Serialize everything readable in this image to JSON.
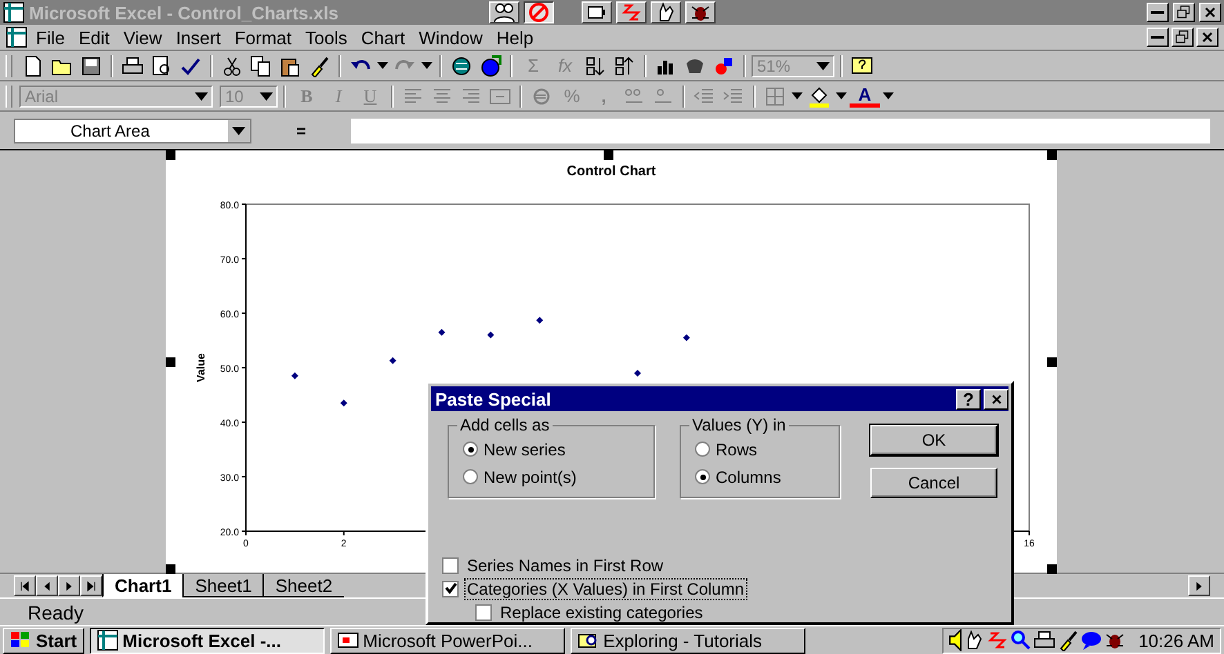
{
  "window": {
    "title": "Microsoft Excel - Control_Charts.xls"
  },
  "menu": [
    "File",
    "Edit",
    "View",
    "Insert",
    "Format",
    "Tools",
    "Chart",
    "Window",
    "Help"
  ],
  "standard_toolbar": {
    "sum": "Σ",
    "function": "fx",
    "zoom": "51%"
  },
  "formatting_toolbar": {
    "font": "Arial",
    "size": "10",
    "bold": "B",
    "italic": "I",
    "underline": "U",
    "percent": "%",
    "comma": ",",
    "font_color": "A",
    "disabled": true
  },
  "formula_bar": {
    "name_box": "Chart Area",
    "equals": "="
  },
  "chart": {
    "chart_data": {
      "type": "scatter",
      "title": "Control Chart",
      "ylabel": "Value",
      "x": [
        1,
        2,
        3,
        4,
        5,
        6,
        8,
        9
      ],
      "series": [
        {
          "color": "#000080",
          "values": [
            48.5,
            43.5,
            51.3,
            56.5,
            56.0,
            58.7,
            49.0,
            55.5
          ]
        }
      ],
      "xlim": [
        0,
        16
      ],
      "ylim": [
        20,
        80
      ],
      "xticks": [
        0,
        2,
        16
      ],
      "yticks": [
        {
          "value": 20,
          "label": "20.0"
        },
        {
          "value": 30,
          "label": "30.0"
        },
        {
          "value": 40,
          "label": "40.0"
        },
        {
          "value": 50,
          "label": "50.0"
        },
        {
          "value": 60,
          "label": "60.0"
        },
        {
          "value": 70,
          "label": "70.0"
        },
        {
          "value": 80,
          "label": "80.0"
        }
      ]
    }
  },
  "sheet_tabs": [
    {
      "label": "Chart1",
      "selected": true
    },
    {
      "label": "Sheet1",
      "selected": false
    },
    {
      "label": "Sheet2",
      "selected": false
    }
  ],
  "status_bar": {
    "text": "Ready"
  },
  "dialog": {
    "title": "Paste Special",
    "help": "?",
    "add_cells_as": {
      "label": "Add cells as",
      "options": [
        {
          "label": "New series",
          "selected": true
        },
        {
          "label": "New point(s)",
          "selected": false
        }
      ]
    },
    "values_in": {
      "label": "Values (Y) in",
      "options": [
        {
          "label": "Rows",
          "selected": false
        },
        {
          "label": "Columns",
          "selected": true
        }
      ]
    },
    "buttons": [
      "OK",
      "Cancel"
    ],
    "checkboxes": [
      {
        "label": "Series Names in First Row",
        "checked": false,
        "focused": false
      },
      {
        "label": "Categories (X Values) in First Column",
        "checked": true,
        "focused": true,
        "children": [
          {
            "label": "Replace existing categories",
            "checked": false,
            "focused": false
          }
        ]
      }
    ]
  },
  "taskbar": {
    "start": "Start",
    "tasks": [
      {
        "label": "Microsoft Excel -...",
        "selected": true
      },
      {
        "label": "Microsoft PowerPoi...",
        "selected": false
      },
      {
        "label": "Exploring - Tutorials",
        "selected": false
      }
    ],
    "clock": "10:26 AM"
  }
}
